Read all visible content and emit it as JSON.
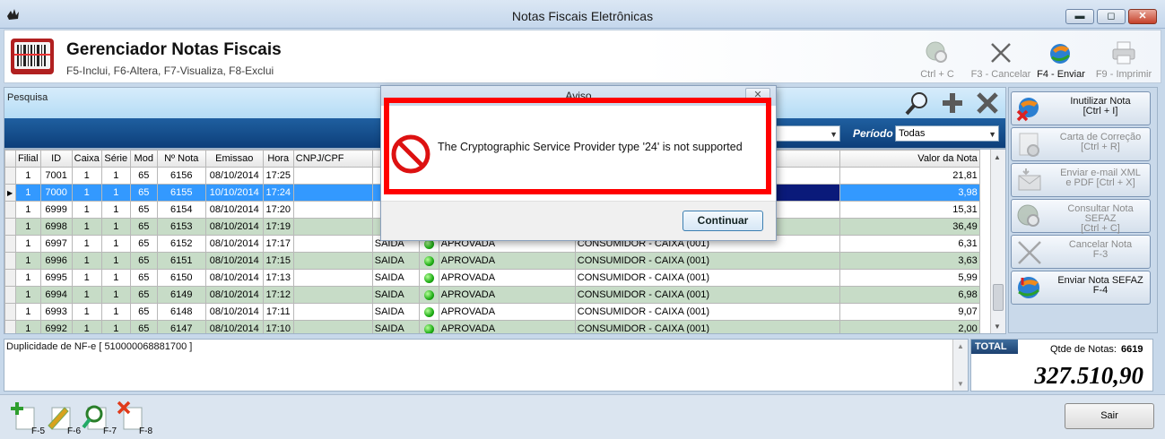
{
  "window": {
    "title": "Notas Fiscais Eletrônicas",
    "minimize_glyph": "▬",
    "maximize_glyph": "◻",
    "close_glyph": "✕"
  },
  "header": {
    "title": "Gerenciador Notas Fiscais",
    "subtitle": "F5-Inclui, F6-Altera, F7-Visualiza, F8-Exclui",
    "logo_icon": "barcode-icon",
    "buttons": [
      {
        "label": "Ctrl + C",
        "icon": "globe-search-icon",
        "enabled": false
      },
      {
        "label": "F3 - Cancelar",
        "icon": "x-icon",
        "enabled": false
      },
      {
        "label": "F4 - Enviar",
        "icon": "send-globe-icon",
        "enabled": true
      },
      {
        "label": "F9 - Imprimir",
        "icon": "printer-icon",
        "enabled": false
      }
    ]
  },
  "search": {
    "label": "Pesquisa",
    "periodo_label": "Período",
    "periodo_value": "Todas",
    "status_value": ""
  },
  "grid": {
    "columns": [
      "Filial",
      "ID",
      "Caixa",
      "Série",
      "Mod",
      "Nº Nota",
      "Emissao",
      "Hora",
      "CNPJ/CPF",
      "",
      "",
      "",
      "",
      "Valor da Nota"
    ],
    "rows": [
      {
        "filial": "1",
        "id": "7001",
        "caixa": "1",
        "serie": "1",
        "mod": "65",
        "nota": "6156",
        "emissao": "08/10/2014",
        "hora": "17:25",
        "tipo": "",
        "status": "",
        "cliente": "",
        "valor": "21,81",
        "style": ""
      },
      {
        "filial": "1",
        "id": "7000",
        "caixa": "1",
        "serie": "1",
        "mod": "65",
        "nota": "6155",
        "emissao": "10/10/2014",
        "hora": "17:24",
        "tipo": "",
        "status": "",
        "cliente": "",
        "valor": "3,98",
        "style": "sel"
      },
      {
        "filial": "1",
        "id": "6999",
        "caixa": "1",
        "serie": "1",
        "mod": "65",
        "nota": "6154",
        "emissao": "08/10/2014",
        "hora": "17:20",
        "tipo": "",
        "status": "",
        "cliente": "",
        "valor": "15,31",
        "style": ""
      },
      {
        "filial": "1",
        "id": "6998",
        "caixa": "1",
        "serie": "1",
        "mod": "65",
        "nota": "6153",
        "emissao": "08/10/2014",
        "hora": "17:19",
        "tipo": "",
        "status": "",
        "cliente": "",
        "valor": "36,49",
        "style": "alt"
      },
      {
        "filial": "1",
        "id": "6997",
        "caixa": "1",
        "serie": "1",
        "mod": "65",
        "nota": "6152",
        "emissao": "08/10/2014",
        "hora": "17:17",
        "tipo": "SAIDA",
        "status": "APROVADA",
        "cliente": "CONSUMIDOR - CAIXA (001)",
        "valor": "6,31",
        "style": ""
      },
      {
        "filial": "1",
        "id": "6996",
        "caixa": "1",
        "serie": "1",
        "mod": "65",
        "nota": "6151",
        "emissao": "08/10/2014",
        "hora": "17:15",
        "tipo": "SAIDA",
        "status": "APROVADA",
        "cliente": "CONSUMIDOR - CAIXA (001)",
        "valor": "3,63",
        "style": "alt"
      },
      {
        "filial": "1",
        "id": "6995",
        "caixa": "1",
        "serie": "1",
        "mod": "65",
        "nota": "6150",
        "emissao": "08/10/2014",
        "hora": "17:13",
        "tipo": "SAIDA",
        "status": "APROVADA",
        "cliente": "CONSUMIDOR - CAIXA (001)",
        "valor": "5,99",
        "style": ""
      },
      {
        "filial": "1",
        "id": "6994",
        "caixa": "1",
        "serie": "1",
        "mod": "65",
        "nota": "6149",
        "emissao": "08/10/2014",
        "hora": "17:12",
        "tipo": "SAIDA",
        "status": "APROVADA",
        "cliente": "CONSUMIDOR - CAIXA (001)",
        "valor": "6,98",
        "style": "alt"
      },
      {
        "filial": "1",
        "id": "6993",
        "caixa": "1",
        "serie": "1",
        "mod": "65",
        "nota": "6148",
        "emissao": "08/10/2014",
        "hora": "17:11",
        "tipo": "SAIDA",
        "status": "APROVADA",
        "cliente": "CONSUMIDOR - CAIXA (001)",
        "valor": "9,07",
        "style": ""
      },
      {
        "filial": "1",
        "id": "6992",
        "caixa": "1",
        "serie": "1",
        "mod": "65",
        "nota": "6147",
        "emissao": "08/10/2014",
        "hora": "17:10",
        "tipo": "SAIDA",
        "status": "APROVADA",
        "cliente": "CONSUMIDOR - CAIXA (001)",
        "valor": "2,00",
        "style": "alt"
      }
    ]
  },
  "side_buttons": [
    {
      "label": "Inutilizar Nota\n[Ctrl + I]",
      "icon": "globe-x-icon",
      "enabled": true
    },
    {
      "label": "Carta de Correção\n[Ctrl + R]",
      "icon": "document-gear-icon",
      "enabled": false
    },
    {
      "label": "Enviar e-mail XML\ne PDF  [Ctrl + X]",
      "icon": "email-icon",
      "enabled": false
    },
    {
      "label": "Consultar Nota SEFAZ\n[Ctrl + C]",
      "icon": "globe-search-icon",
      "enabled": false
    },
    {
      "label": "Cancelar Nota\nF-3",
      "icon": "x-icon",
      "enabled": false
    },
    {
      "label": "Enviar Nota SEFAZ\nF-4",
      "icon": "send-globe-icon",
      "enabled": true
    }
  ],
  "message": {
    "text": "Duplicidade de NF-e [ 510000068881700 ]"
  },
  "totals": {
    "total_label": "TOTAL",
    "qtde_label": "Qtde de Notas:",
    "qtde_value": "6619",
    "total_value": "327.510,90"
  },
  "footer": {
    "buttons": [
      {
        "key": "F-5",
        "icon": "add-document-icon"
      },
      {
        "key": "F-6",
        "icon": "edit-document-icon"
      },
      {
        "key": "F-7",
        "icon": "search-document-icon"
      },
      {
        "key": "F-8",
        "icon": "delete-document-icon"
      }
    ],
    "sair_label": "Sair"
  },
  "dialog": {
    "title": "Aviso",
    "message": "The Cryptographic Service Provider type '24' is not supported",
    "button_label": "Continuar",
    "close_glyph": "✕",
    "icon": "error-prohibited-icon"
  },
  "colors": {
    "accent": "#0d3f7a",
    "selection": "#3399ff",
    "alt_row": "#c7dcc7",
    "highlight_box": "#ff0000"
  }
}
